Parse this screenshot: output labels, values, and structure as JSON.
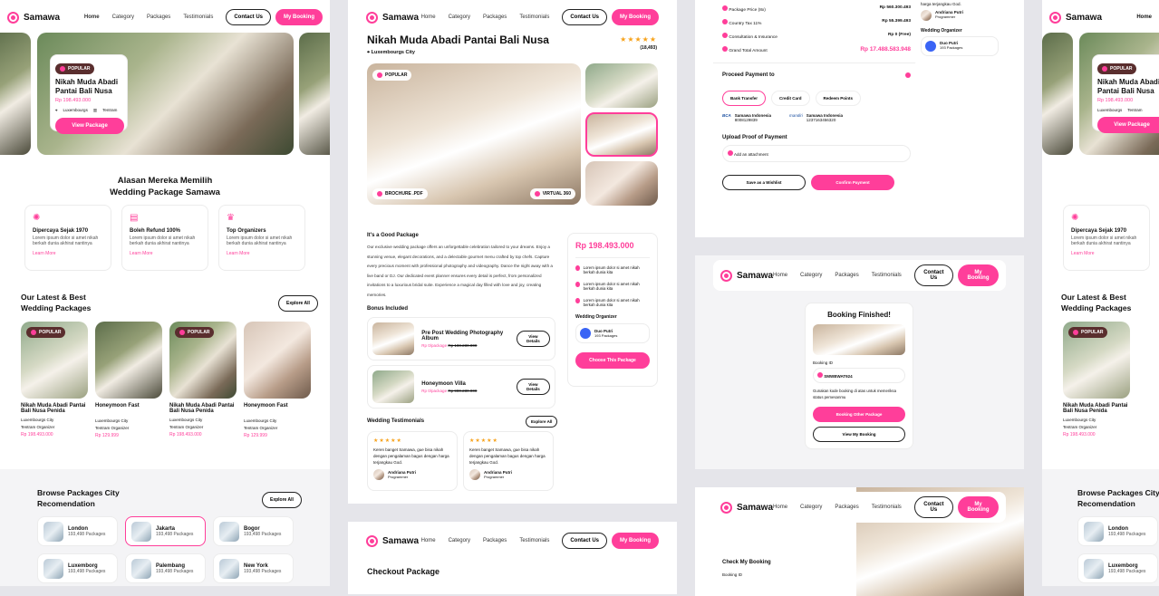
{
  "brand": "Samawa",
  "nav": {
    "items": [
      "Home",
      "Category",
      "Packages",
      "Testimonials"
    ],
    "contact": "Contact Us",
    "booking": "My Booking"
  },
  "home": {
    "hero": {
      "badge": "POPULAR",
      "title": "Nikah Muda Abadi Pantai Bali Nusa",
      "price": "Rp 198.493.000",
      "city": "Luxembourgs",
      "org": "Tentram",
      "cta": "View Package"
    },
    "why": {
      "title": "Alasan Mereka Memilih Wedding Package Samawa",
      "items": [
        {
          "title": "Dipercaya Sejak 1970",
          "desc": "Lorem ipsum dolor si amet nikah berkah dunia akhirat nantinya",
          "link": "Learn More"
        },
        {
          "title": "Boleh Refund 100%",
          "desc": "Lorem ipsum dolor si amet nikah berkah dunia akhirat nantinya",
          "link": "Learn More"
        },
        {
          "title": "Top Organizers",
          "desc": "Lorem ipsum dolor si amet nikah berkah dunia akhirat nantinya",
          "link": "Learn More"
        }
      ]
    },
    "latest": {
      "title": "Our Latest & Best Wedding Packages",
      "explore": "Explore All",
      "items": [
        {
          "badge": "POPULAR",
          "name": "Nikah Muda Abadi Pantai Bali Nusa Penida",
          "city": "Luxembourgs City",
          "org": "Tentram Organizer",
          "price": "Rp 198.493.000"
        },
        {
          "badge": "",
          "name": "Honeymoon Fast",
          "city": "Luxembourgs City",
          "org": "Tentram Organizer",
          "price": "Rp 129.999"
        },
        {
          "badge": "POPULAR",
          "name": "Nikah Muda Abadi Pantai Bali Nusa Penida",
          "city": "Luxembourgs City",
          "org": "Tentram Organizer",
          "price": "Rp 198.493.000"
        },
        {
          "badge": "",
          "name": "Honeymoon Fast",
          "city": "Luxembourgs City",
          "org": "Tentram Organizer",
          "price": "Rp 129.999"
        }
      ]
    },
    "cities": {
      "title": "Browse Packages City Recomendation",
      "explore": "Explore All",
      "items": [
        {
          "name": "London",
          "count": "193,498 Packages"
        },
        {
          "name": "Jakarta",
          "count": "193,498 Packages"
        },
        {
          "name": "Bogor",
          "count": "193,498 Packages"
        },
        {
          "name": "Luxemborg",
          "count": "193,498 Packages"
        },
        {
          "name": "Palembang",
          "count": "193,498 Packages"
        },
        {
          "name": "New York",
          "count": "193,498 Packages"
        }
      ]
    }
  },
  "detail": {
    "title": "Nikah Muda Abadi Pantai Bali Nusa",
    "city": "Luxembourgs City",
    "stars": "★★★★★",
    "reviews": "(18,493)",
    "badge": "POPULAR",
    "brochure": "BROCHURE .PDF",
    "virtual": "VIRTUAL 360",
    "good_title": "It's a Good Package",
    "good_desc": "Our exclusive wedding package offers an unforgettable celebration tailored to your dreams. Enjoy a stunning venue, elegant decorations, and a delectable gourmet menu crafted by top chefs. Capture every precious moment with professional photography and videography. Dance the night away with a live band or DJ. Our dedicated event planner ensures every detail is perfect, from personalized invitations to a luxurious bridal suite. Experience a magical day filled with love and joy, creating memories.",
    "bonus_title": "Bonus Included",
    "bonus": [
      {
        "name": "Pre Post Wedding Photography Album",
        "price": "Rp 0/package",
        "old": "Rp 188.230.000",
        "btn": "View Details"
      },
      {
        "name": "Honeymoon Villa",
        "price": "Rp 0/package",
        "old": "Rp 980.230.000",
        "btn": "View Details"
      }
    ],
    "testi_title": "Wedding Testimonials",
    "testi_explore": "Explore All",
    "testi": [
      {
        "text": "Keren banget Samawa, gue bisa nikah dengan pengalaman bagus dengan harga terjangkau God.",
        "name": "Andriana Putri",
        "role": "Programmer"
      },
      {
        "text": "Keren banget Samawa, gue bisa nikah dengan pengalaman bagus dengan harga terjangkau God.",
        "name": "Andriana Putri",
        "role": "Programmer"
      }
    ],
    "price": "Rp 198.493.000",
    "perks": [
      "Lorem ipsum dolor si amet nikah berkah dunia kita",
      "Lorem ipsum dolor si amet nikah berkah dunia kita",
      "Lorem ipsum dolor si amet nikah berkah dunia kita"
    ],
    "org_title": "Wedding Organizer",
    "org_name": "Duo Putri",
    "org_count": "193 Packages",
    "cta": "Choose This Package",
    "checkout_title": "Checkout Package"
  },
  "payment": {
    "rows": [
      {
        "label": "Package Price (8x)",
        "value": "Rp 560.300.493"
      },
      {
        "label": "Country Tax 11%",
        "value": "Rp 55.399.493"
      },
      {
        "label": "Consultation & Insurance",
        "value": "Rp 0 (Free)"
      },
      {
        "label": "Grand Total Amount",
        "value": "Rp 17.488.583.948"
      }
    ],
    "proceed": "Proceed Payment to",
    "tabs": [
      "Bank Transfer",
      "Credit Card",
      "Redeem Points"
    ],
    "banks": [
      {
        "logo": "BCA",
        "name": "Samawa Indonesia",
        "acc": "8008129839"
      },
      {
        "logo": "mandiri",
        "name": "Samawa Indonesia",
        "acc": "1237163456320"
      }
    ],
    "upload": "Upload Proof of Payment",
    "attach": "Add an attachment",
    "wish": "Save as a Wishlist",
    "confirm": "Confirm Payment",
    "side_quote": "harga terjangkau God.",
    "side_name": "Andriana Putri",
    "side_role": "Programmer",
    "side_org_title": "Wedding Organizer",
    "side_org": "Duo Putri",
    "side_count": "193 Packages"
  },
  "finished": {
    "title": "Booking Finished!",
    "id_label": "Booking ID",
    "id": "SMWBWAT924",
    "note": "Gunakan kode booking di atas untuk memeriksa status pemesanmu",
    "other": "Booking Other Package",
    "view": "View My Booking"
  },
  "check": {
    "title": "Check My Booking",
    "id_label": "Booking ID"
  }
}
